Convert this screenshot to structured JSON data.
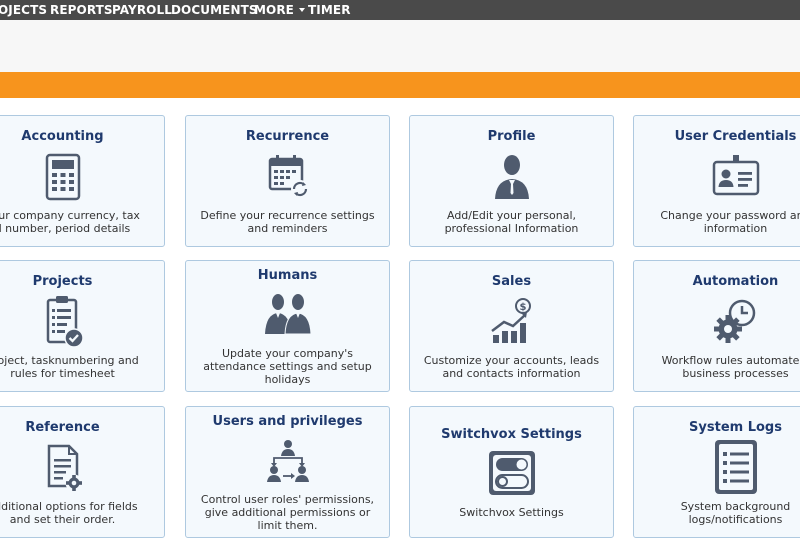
{
  "nav": {
    "items": [
      "OJECTS",
      "REPORTS",
      "PAYROLL",
      "DOCUMENTS",
      "MORE",
      "TIMER"
    ]
  },
  "colors": {
    "nav_bg": "#4a4a4a",
    "accent_orange": "#f7941d",
    "card_bg": "#f4f9fd",
    "card_border": "#aec9e0",
    "title_blue": "#1f3a6e",
    "icon_slate": "#4f5b6e"
  },
  "cards": [
    {
      "title": "Accounting",
      "icon": "calculator-icon",
      "desc": [
        "your company currency, tax",
        "d number, period details"
      ]
    },
    {
      "title": "Recurrence",
      "icon": "calendar-refresh-icon",
      "desc": [
        "Define your recurrence settings",
        "and reminders"
      ]
    },
    {
      "title": "Profile",
      "icon": "person-icon",
      "desc": [
        "Add/Edit your personal,",
        "professional Information"
      ]
    },
    {
      "title": "User Credentials",
      "icon": "id-card-icon",
      "desc": [
        "Change your password and",
        "information"
      ]
    },
    {
      "title": "Projects",
      "icon": "clipboard-check-icon",
      "desc": [
        "project, tasknumbering and",
        "rules for timesheet"
      ]
    },
    {
      "title": "Humans",
      "icon": "people-icon",
      "desc": [
        "Update your company's",
        "attendance settings and setup",
        "holidays"
      ]
    },
    {
      "title": "Sales",
      "icon": "sales-chart-icon",
      "desc": [
        "Customize your accounts, leads",
        "and contacts information"
      ]
    },
    {
      "title": "Automation",
      "icon": "gear-clock-icon",
      "desc": [
        "Workflow rules automate y",
        "business processes"
      ]
    },
    {
      "title": "Reference",
      "icon": "document-gear-icon",
      "desc": [
        "additional options for fields",
        "and set their order."
      ]
    },
    {
      "title": "Users and privileges",
      "icon": "user-hierarchy-icon",
      "desc": [
        "Control user roles' permissions,",
        "give additional permissions or",
        "limit them."
      ]
    },
    {
      "title": "Switchvox Settings",
      "icon": "toggle-switch-icon",
      "desc": [
        "Switchvox Settings"
      ]
    },
    {
      "title": "System Logs",
      "icon": "log-list-icon",
      "desc": [
        "System background",
        "logs/notifications"
      ]
    }
  ]
}
